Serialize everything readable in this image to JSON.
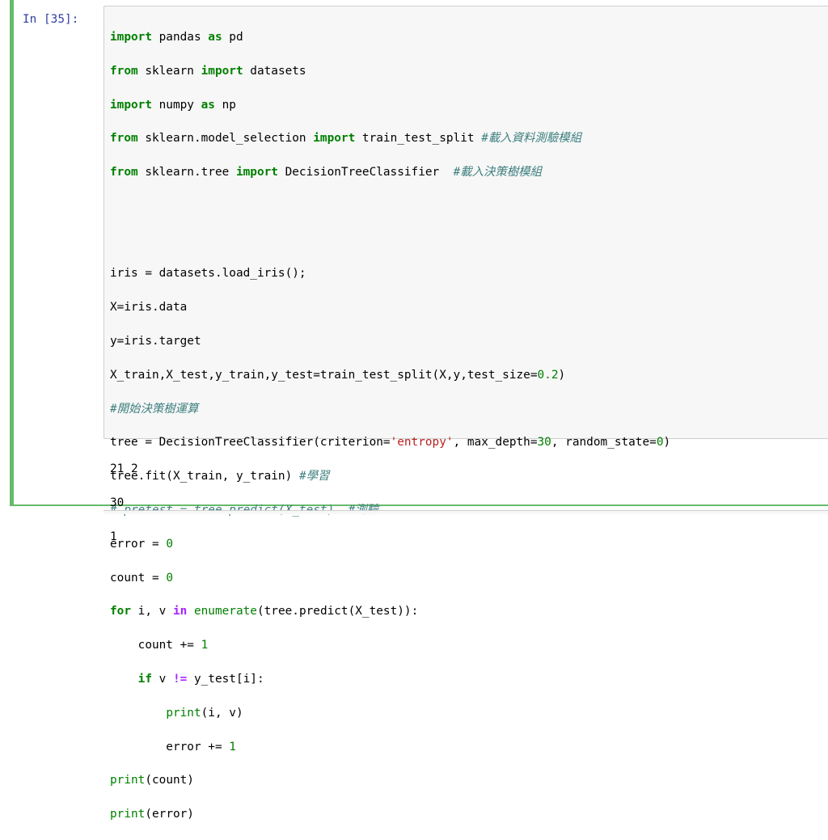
{
  "cell": {
    "prompt": "In [35]:",
    "code": {
      "l1": {
        "a": "import",
        "b": " pandas ",
        "c": "as",
        "d": " pd"
      },
      "l2": {
        "a": "from",
        "b": " sklearn ",
        "c": "import",
        "d": " datasets"
      },
      "l3": {
        "a": "import",
        "b": " numpy ",
        "c": "as",
        "d": " np"
      },
      "l4": {
        "a": "from",
        "b": " sklearn.model_selection ",
        "c": "import",
        "d": " train_test_split ",
        "e": "#載入資料測驗模組"
      },
      "l5": {
        "a": "from",
        "b": " sklearn.tree ",
        "c": "import",
        "d": " DecisionTreeClassifier  ",
        "e": "#載入決策樹模組"
      },
      "l8": {
        "a": "iris = datasets.load_iris();"
      },
      "l9": {
        "a": "X=iris.data"
      },
      "l10": {
        "a": "y=iris.target"
      },
      "l11": {
        "a": "X_train,X_test,y_train,y_test=train_test_split(X,y,test_size=",
        "b": "0.2",
        "c": ")"
      },
      "l12": {
        "a": "#開始決策樹運算"
      },
      "l13": {
        "a": "tree = DecisionTreeClassifier(criterion=",
        "b": "'entropy'",
        "c": ", max_depth=",
        "d": "30",
        "e": ", random_state=",
        "f": "0",
        "g": ")"
      },
      "l14": {
        "a": "tree.fit(X_train, y_train) ",
        "b": "#學習"
      },
      "l15": {
        "a": "# pretest = tree.predict(X_test)  #測驗"
      },
      "l16": {
        "a": "error = ",
        "b": "0"
      },
      "l17": {
        "a": "count = ",
        "b": "0"
      },
      "l18": {
        "a": "for",
        "b": " i, v ",
        "c": "in",
        "d": " ",
        "e": "enumerate",
        "f": "(tree.predict(X_test)):"
      },
      "l19": {
        "a": "    count += ",
        "b": "1"
      },
      "l20": {
        "a": "    ",
        "b": "if",
        "c": " v ",
        "d": "!=",
        "e": " y_test[i]:"
      },
      "l21": {
        "a": "        ",
        "b": "print",
        "c": "(i, v)"
      },
      "l22": {
        "a": "        error += ",
        "b": "1"
      },
      "l23": {
        "a": "print",
        "b": "(count)"
      },
      "l24": {
        "a": "print",
        "b": "(error)"
      }
    },
    "output": [
      "21 2",
      "30",
      "1"
    ]
  }
}
